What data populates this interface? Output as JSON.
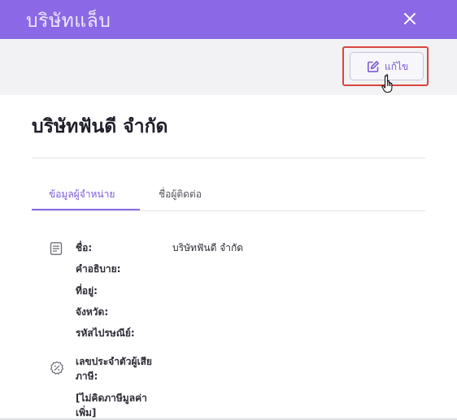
{
  "header": {
    "title": "บริษัทแล็บ",
    "close_icon": "close-icon"
  },
  "toolbar": {
    "edit_label": "แก้ไข",
    "edit_icon": "edit-icon"
  },
  "company": {
    "title": "บริษัทฟันดี จำกัด"
  },
  "tabs": [
    {
      "label": "ข้อมูลผู้จำหน่าย",
      "active": true
    },
    {
      "label": "ชื่อผู้ติดต่อ",
      "active": false
    }
  ],
  "details": {
    "general_icon": "document-icon",
    "name_label": "ชื่อ:",
    "name_value": "บริษัทฟันดี จำกัด",
    "description_label": "คำอธิบาย:",
    "address_label": "ที่อยู่:",
    "province_label": "จังหวัด:",
    "postal_label": "รหัสไปรษณีย์:",
    "tax_icon": "percent-badge-icon",
    "tax_id_label_1": "เลขประจำตัวผู้เสีย",
    "tax_id_label_2": "ภาษี:",
    "vat_label_1": "[ไม่คิดภาษีมูลค่า",
    "vat_label_2": "เพิ่ม]"
  },
  "colors": {
    "accent": "#8b69e6",
    "highlight": "#d9453c"
  }
}
